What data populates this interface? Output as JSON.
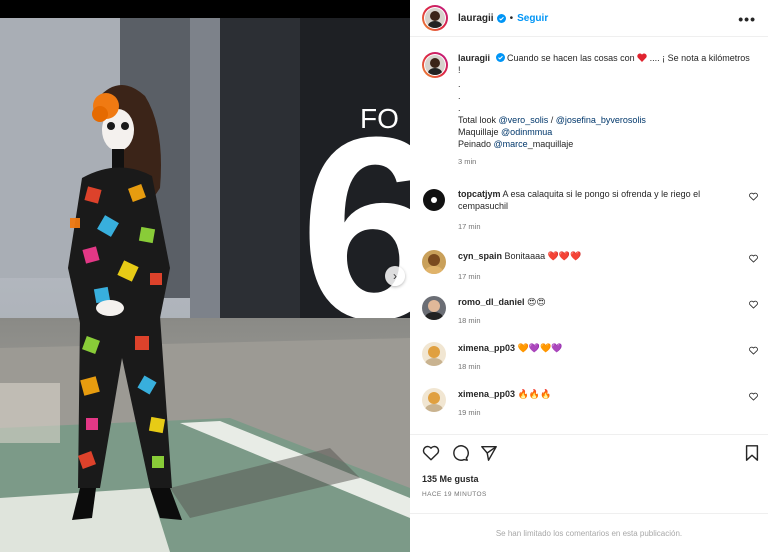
{
  "post": {
    "username": "lauragii",
    "separator": "•",
    "follow_label": "Seguir",
    "more_label": "•••"
  },
  "caption": {
    "username": "lauragii",
    "text_1": "Cuando se hacen las cosas con",
    "text_2": ".... ¡ Se nota a kilómetros !",
    "dots": [
      ".",
      ".",
      "."
    ],
    "look_prefix": "Total look",
    "look_mention_1": "@vero_solis",
    "look_sep": " / ",
    "look_mention_2": "@josefina_byverosolis",
    "makeup_prefix": "Maquillaje",
    "makeup_mention": "@odinmmua",
    "hair_prefix": "Peinado",
    "hair_mention": "@marce",
    "hair_suffix": "_maquillaje",
    "time": "3 min"
  },
  "comments": [
    {
      "user": "topcatjym",
      "text": "A esa calaquita si le pongo si ofrenda y le riego el cempasuchil",
      "time": "17 min"
    },
    {
      "user": "cyn_spain",
      "text": "Bonitaaaa",
      "emoji": "❤️❤️❤️",
      "time": "17 min"
    },
    {
      "user": "romo_dl_daniel",
      "text": "",
      "emoji": "😍😍",
      "time": "18 min"
    },
    {
      "user": "ximena_pp03",
      "text": "",
      "emoji": "🧡💜🧡💜",
      "time": "18 min"
    },
    {
      "user": "ximena_pp03",
      "text": "",
      "emoji": "🔥🔥🔥",
      "time": "19 min"
    }
  ],
  "likes": "135 Me gusta",
  "posted_ago": "HACE 19 MINUTOS",
  "comments_limited": "Se han limitado los comentarios en esta publicación.",
  "photo_sign_text": "FO",
  "photo_sign_number": "6",
  "colors": {
    "link": "#00376b",
    "follow": "#0095f6",
    "muted": "#737373"
  }
}
